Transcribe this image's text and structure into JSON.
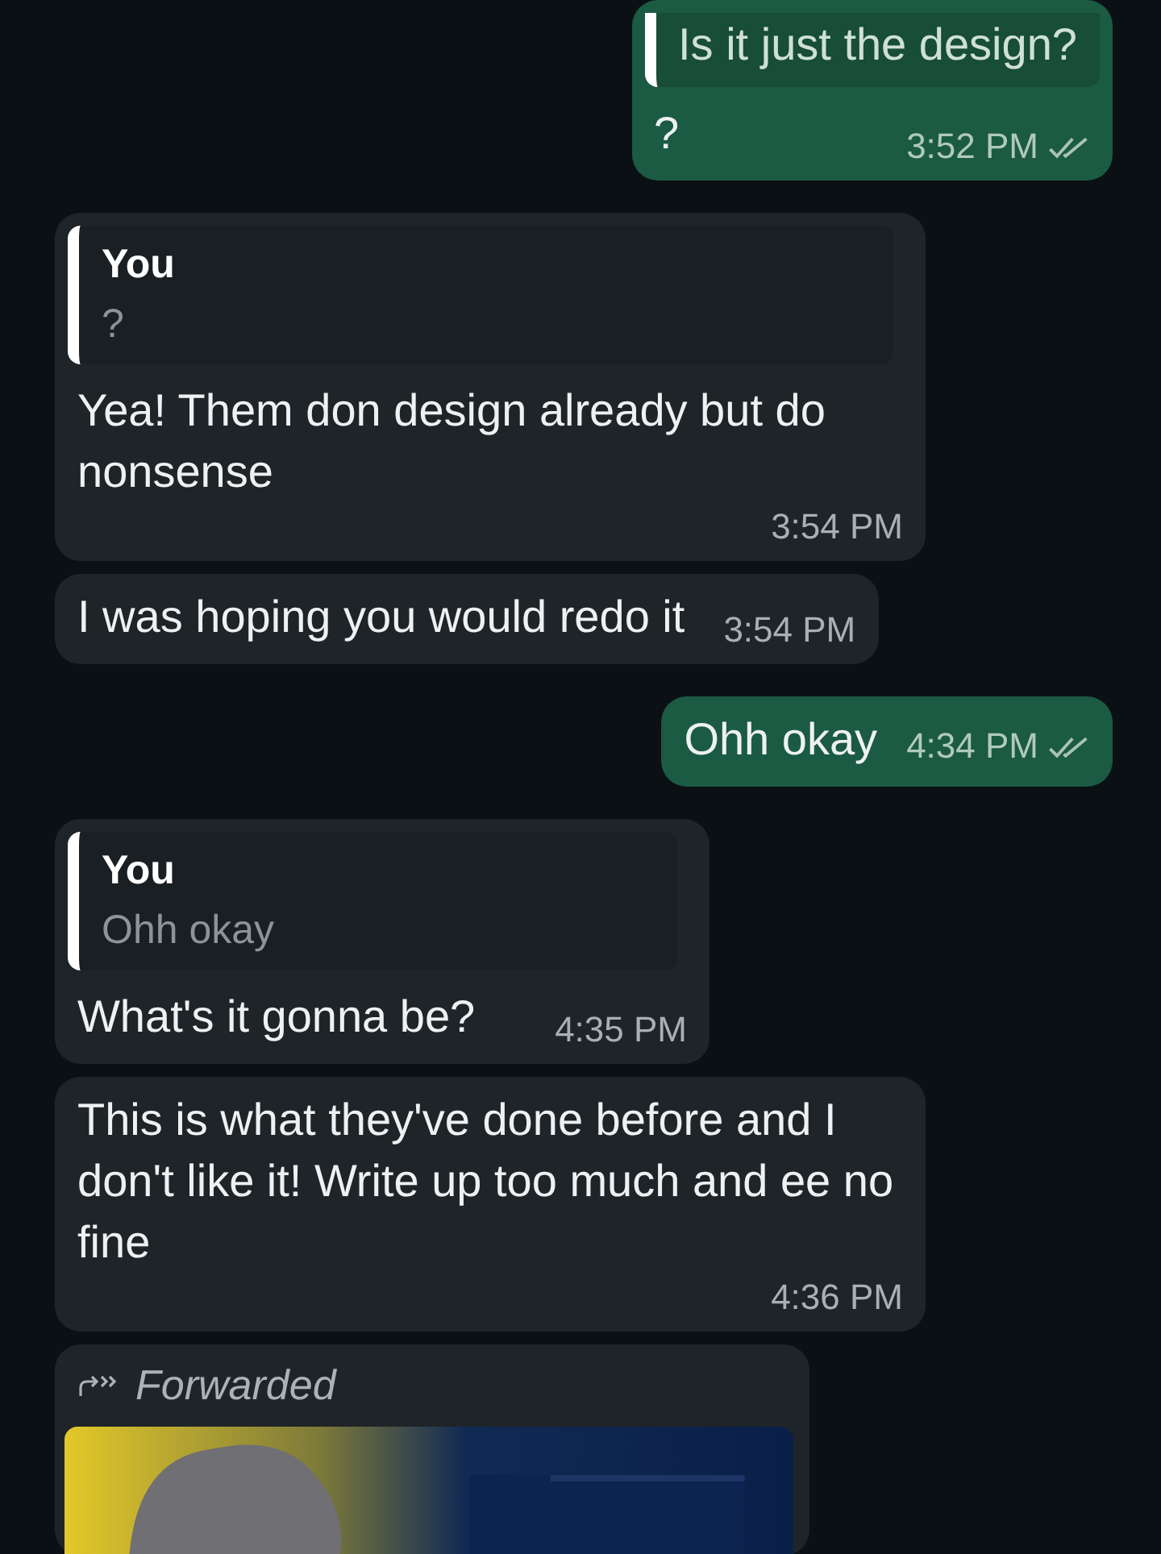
{
  "messages": [
    {
      "kind": "text",
      "outgoing": true,
      "quote": {
        "text": "Is it just the design?"
      },
      "text": "?",
      "time": "3:52 PM",
      "read": false
    },
    {
      "kind": "text",
      "outgoing": false,
      "quote": {
        "author": "You",
        "text": "?"
      },
      "text": "Yea! Them don design already but do nonsense",
      "time": "3:54 PM"
    },
    {
      "kind": "text",
      "outgoing": false,
      "text": "I was hoping you would redo it",
      "time": "3:54 PM"
    },
    {
      "kind": "text",
      "outgoing": true,
      "text": "Ohh okay",
      "time": "4:34 PM",
      "read": false
    },
    {
      "kind": "text",
      "outgoing": false,
      "quote": {
        "author": "You",
        "text": "Ohh okay"
      },
      "text": "What's it gonna be?",
      "time": "4:35 PM"
    },
    {
      "kind": "text",
      "outgoing": false,
      "text": "This is what they've done before and I don't like it! Write up too much and ee no fine",
      "time": "4:36 PM"
    },
    {
      "kind": "forwarded_image",
      "outgoing": false,
      "label": "Forwarded"
    }
  ]
}
